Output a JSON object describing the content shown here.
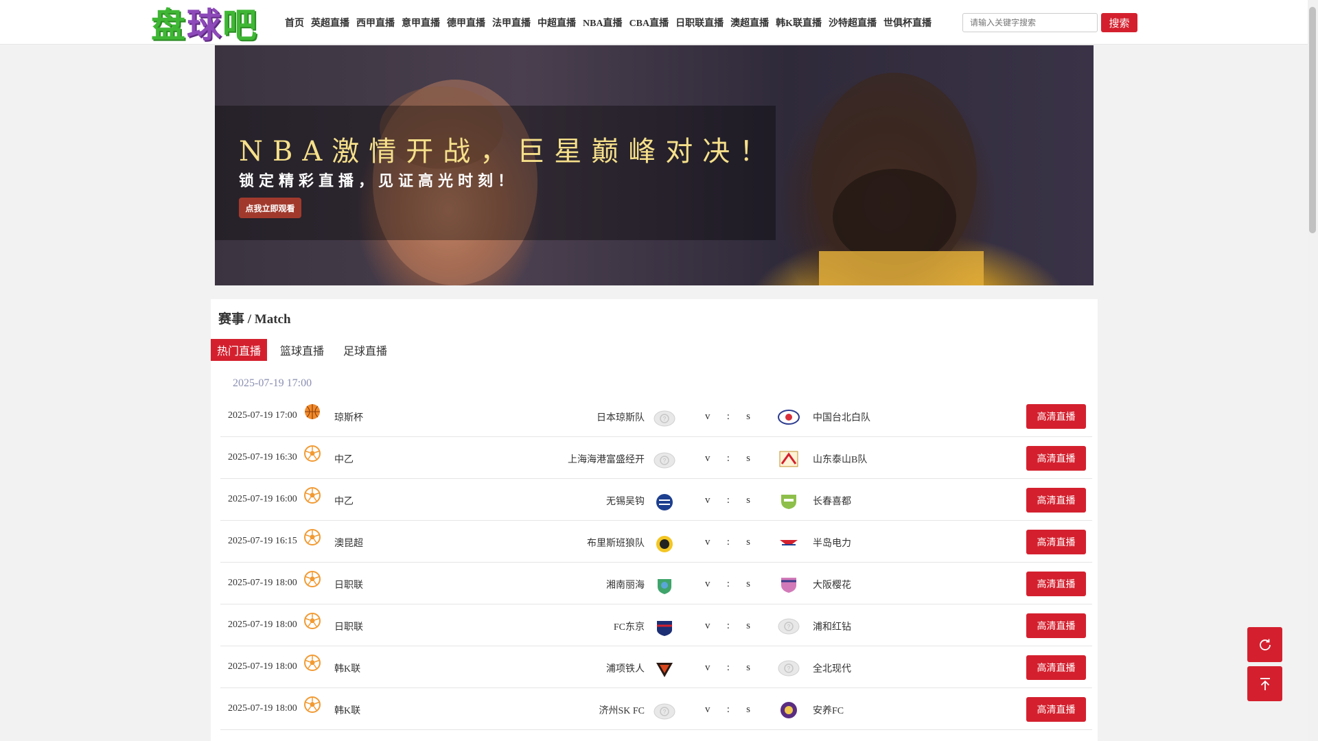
{
  "header": {
    "logo": "盘球吧",
    "nav": [
      "首页",
      "英超直播",
      "西甲直播",
      "意甲直播",
      "德甲直播",
      "法甲直播",
      "中超直播",
      "NBA直播",
      "CBA直播",
      "日职联直播",
      "澳超直播",
      "韩K联直播",
      "沙特超直播",
      "世俱杯直播"
    ],
    "search_placeholder": "请输入关键字搜索",
    "search_button": "搜索"
  },
  "banner": {
    "title": "NBA激情开战，巨星巅峰对决！",
    "subtitle": "锁定精彩直播，见证高光时刻！",
    "button": "点我立即观看"
  },
  "matches_panel": {
    "title": "赛事 / Match",
    "tabs": [
      "热门直播",
      "篮球直播",
      "足球直播"
    ],
    "active_tab": "热门直播",
    "date_heading": "2025-07-19 17:00",
    "vs_text": [
      "v",
      ":",
      "s"
    ],
    "live_label": "高清直播",
    "rows": [
      {
        "time": "2025-07-19 17:00",
        "sport": "basketball",
        "league": "琼斯杯",
        "home": "日本琼斯队",
        "home_logo": "placeholder",
        "away": "中国台北白队",
        "away_logo": "taipei"
      },
      {
        "time": "2025-07-19 16:30",
        "sport": "football",
        "league": "中乙",
        "home": "上海海港富盛经开",
        "home_logo": "placeholder",
        "away": "山东泰山B队",
        "away_logo": "taishan"
      },
      {
        "time": "2025-07-19 16:00",
        "sport": "football",
        "league": "中乙",
        "home": "无锡吴钩",
        "home_logo": "wuxi",
        "away": "长春喜都",
        "away_logo": "changchun"
      },
      {
        "time": "2025-07-19 16:15",
        "sport": "football",
        "league": "澳昆超",
        "home": "布里斯班狼队",
        "home_logo": "wolves",
        "away": "半岛电力",
        "away_logo": "peninsula"
      },
      {
        "time": "2025-07-19 18:00",
        "sport": "football",
        "league": "日职联",
        "home": "湘南丽海",
        "home_logo": "shonan",
        "away": "大阪樱花",
        "away_logo": "cerezo"
      },
      {
        "time": "2025-07-19 18:00",
        "sport": "football",
        "league": "日职联",
        "home": "FC东京",
        "home_logo": "fctokyo",
        "away": "浦和红钻",
        "away_logo": "placeholder"
      },
      {
        "time": "2025-07-19 18:00",
        "sport": "football",
        "league": "韩K联",
        "home": "浦项铁人",
        "home_logo": "pohang",
        "away": "全北现代",
        "away_logo": "placeholder"
      },
      {
        "time": "2025-07-19 18:00",
        "sport": "football",
        "league": "韩K联",
        "home": "济州SK FC",
        "home_logo": "placeholder",
        "away": "安养FC",
        "away_logo": "anyang"
      }
    ]
  },
  "colors": {
    "accent": "#d4202e",
    "logo_green": "#3fb735",
    "logo_purple": "#8d49b9",
    "date_heading": "#8a8fb2"
  },
  "floating": {
    "refresh_icon": "refresh-icon",
    "top_icon": "back-to-top-icon"
  }
}
